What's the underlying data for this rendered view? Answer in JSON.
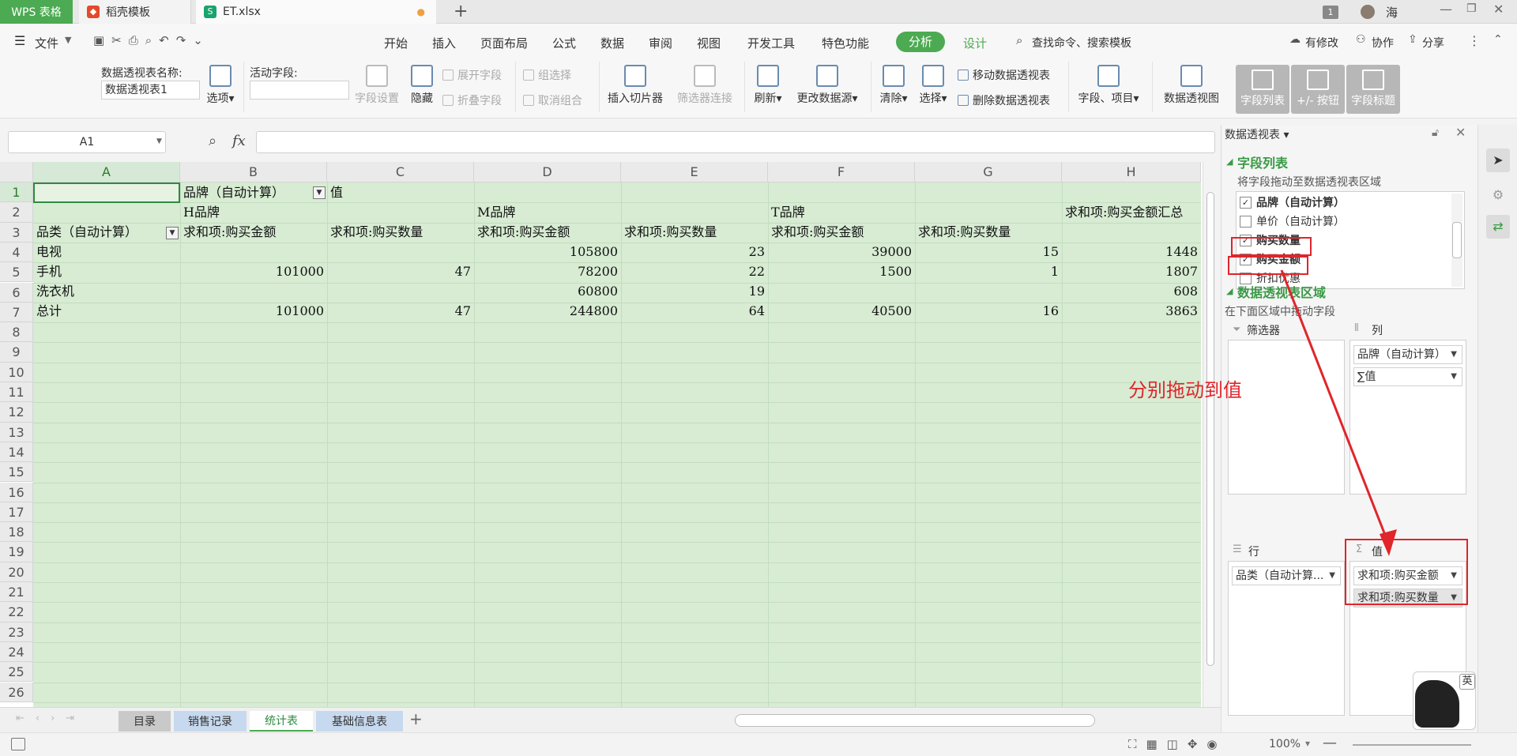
{
  "titlebar": {
    "app_tab": "WPS 表格",
    "template_tab": "稻壳模板",
    "file_tab": "ET.xlsx",
    "new_tab": "+",
    "badge": "1",
    "user": "海"
  },
  "menubar": {
    "file": "文件",
    "items": [
      "开始",
      "插入",
      "页面布局",
      "公式",
      "数据",
      "审阅",
      "视图",
      "开发工具",
      "特色功能"
    ],
    "active_tab": "分析",
    "design_tab": "设计",
    "search": "查找命令、搜索模板",
    "modify": "有修改",
    "collab": "协作",
    "share": "分享"
  },
  "ribbon": {
    "pivot_name_label": "数据透视表名称:",
    "pivot_name_value": "数据透视表1",
    "options": "选项",
    "active_field_label": "活动字段:",
    "field_settings": "字段设置",
    "hide": "隐藏",
    "expand_field": "展开字段",
    "collapse_field": "折叠字段",
    "group_selection": "组选择",
    "ungroup": "取消组合",
    "insert_slicer": "插入切片器",
    "filter_connections": "筛选器连接",
    "refresh": "刷新",
    "change_source": "更改数据源",
    "clear": "清除",
    "select": "选择",
    "move_pivot": "移动数据透视表",
    "delete_pivot": "删除数据透视表",
    "fields_items": "字段、项目",
    "pivot_chart": "数据透视图",
    "field_list": "字段列表",
    "plus_minus": "+/- 按钮",
    "field_headers": "字段标题"
  },
  "formulabar": {
    "name_box": "A1",
    "fx": "fx",
    "value": ""
  },
  "grid": {
    "columns": [
      "A",
      "B",
      "C",
      "D",
      "E",
      "F",
      "G",
      "H"
    ],
    "rows": [
      "1",
      "2",
      "3",
      "4",
      "5",
      "6",
      "7",
      "8",
      "9",
      "10",
      "11",
      "12",
      "13",
      "14",
      "15",
      "16",
      "17",
      "18",
      "19",
      "20",
      "21",
      "22",
      "23",
      "24",
      "25",
      "26"
    ],
    "r1": {
      "b": "品牌（自动计算）",
      "c": "值"
    },
    "r2": {
      "b": "H品牌",
      "d": "M品牌",
      "f": "T品牌",
      "h": "求和项:购买金额汇总"
    },
    "r3": {
      "a": "品类（自动计算）",
      "b": "求和项:购买金额",
      "c": "求和项:购买数量",
      "d": "求和项:购买金额",
      "e": "求和项:购买数量",
      "f": "求和项:购买金额",
      "g": "求和项:购买数量"
    },
    "r4": {
      "a": "电视",
      "b": "",
      "c": "",
      "d": "105800",
      "e": "23",
      "f": "39000",
      "g": "15",
      "h": "1448"
    },
    "r5": {
      "a": "手机",
      "b": "101000",
      "c": "47",
      "d": "78200",
      "e": "22",
      "f": "1500",
      "g": "1",
      "h": "1807"
    },
    "r6": {
      "a": "洗衣机",
      "b": "",
      "c": "",
      "d": "60800",
      "e": "19",
      "f": "",
      "g": "",
      "h": "608"
    },
    "r7": {
      "a": "总计",
      "b": "101000",
      "c": "47",
      "d": "244800",
      "e": "64",
      "f": "40500",
      "g": "16",
      "h": "3863"
    }
  },
  "sheets": [
    "目录",
    "销售记录",
    "统计表",
    "基础信息表"
  ],
  "active_sheet": "统计表",
  "status": {
    "zoom": "100%"
  },
  "pane": {
    "title": "数据透视表",
    "field_list_heading": "字段列表",
    "field_list_hint": "将字段拖动至数据透视表区域",
    "fields": [
      {
        "label": "品牌（自动计算）",
        "checked": true
      },
      {
        "label": "单价（自动计算）",
        "checked": false
      },
      {
        "label": "购买数量",
        "checked": true
      },
      {
        "label": "购买金额",
        "checked": true
      },
      {
        "label": "折扣优惠",
        "checked": false
      }
    ],
    "areas_heading": "数据透视表区域",
    "areas_hint": "在下面区域中拖动字段",
    "filter_label": "筛选器",
    "column_label": "列",
    "row_label": "行",
    "value_label": "值",
    "column_items": [
      "品牌（自动计算）",
      "∑值"
    ],
    "row_items": [
      "品类（自动计算..."
    ],
    "value_items": [
      "求和项:购买金额",
      "求和项:购买数量"
    ]
  },
  "annotation": "分别拖动到值",
  "ime": "英",
  "colors": {
    "accent_green": "#4caa52",
    "pivot_fill": "#d7ecd3",
    "annotation_red": "#e0252b"
  }
}
